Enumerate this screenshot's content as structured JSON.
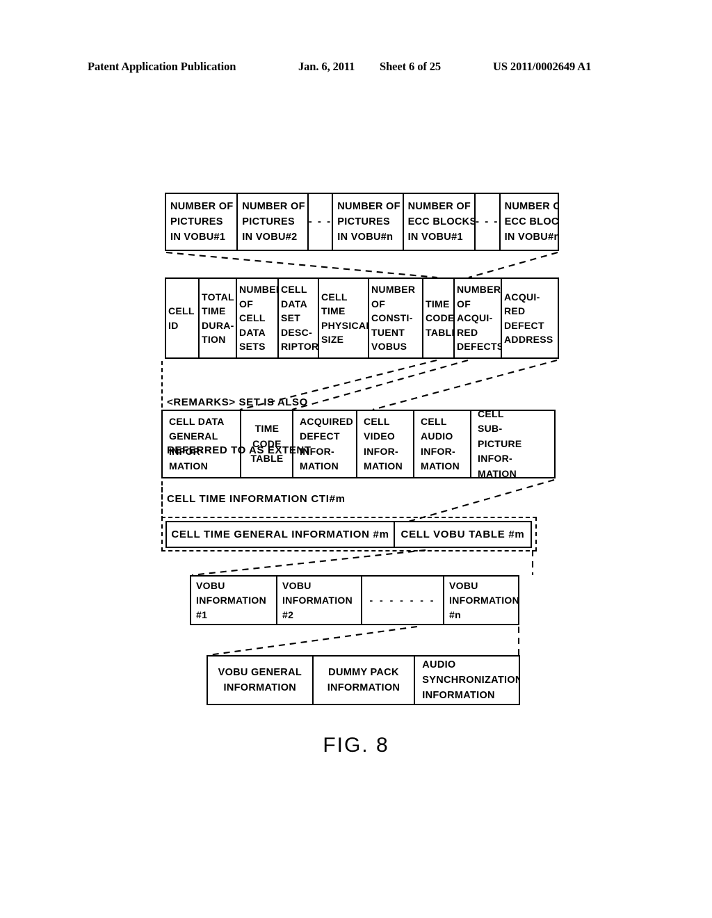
{
  "header": {
    "publication": "Patent Application Publication",
    "date": "Jan. 6, 2011",
    "sheet": "Sheet 6 of 25",
    "patent_number": "US 2011/0002649 A1"
  },
  "figure": {
    "caption": "FIG. 8",
    "remarks": {
      "line1": "<REMARKS> SET IS ALSO",
      "line2": "REFERRED TO AS EXTENT"
    },
    "cti_label": "CELL TIME INFORMATION CTI#m",
    "table1": {
      "name": "vobu-picture-count-table",
      "cells": [
        {
          "lines": [
            "NUMBER OF",
            "PICTURES",
            "IN VOBU#1"
          ],
          "type": "text"
        },
        {
          "lines": [
            "NUMBER OF",
            "PICTURES",
            "IN VOBU#2"
          ],
          "type": "text"
        },
        {
          "lines": [
            "- - -"
          ],
          "type": "ellipsis"
        },
        {
          "lines": [
            "NUMBER OF",
            "PICTURES",
            "IN VOBU#n"
          ],
          "type": "text"
        },
        {
          "lines": [
            "NUMBER OF",
            "ECC BLOCKS",
            "IN VOBU#1"
          ],
          "type": "text"
        },
        {
          "lines": [
            "- - -"
          ],
          "type": "ellipsis"
        },
        {
          "lines": [
            "NUMBER OF",
            "ECC BLOCKS",
            "IN VOBU#n"
          ],
          "type": "text"
        }
      ]
    },
    "table2": {
      "name": "cell-data-set-descriptor-table",
      "cells": [
        {
          "lines": [
            "CELL",
            "ID"
          ]
        },
        {
          "lines": [
            "TOTAL",
            "TIME",
            "DURA-",
            "TION"
          ]
        },
        {
          "lines": [
            "NUMBER",
            "OF",
            "CELL",
            "DATA",
            "SETS"
          ]
        },
        {
          "lines": [
            "CELL",
            "DATA",
            "SET",
            "DESC-",
            "RIPTOR"
          ]
        },
        {
          "lines": [
            "CELL",
            "TIME",
            "PHYSICAL",
            "SIZE"
          ]
        },
        {
          "lines": [
            "NUMBER",
            "OF",
            "CONSTI-",
            "TUENT",
            "VOBUS"
          ]
        },
        {
          "lines": [
            "TIME",
            "CODE",
            "TABLE"
          ]
        },
        {
          "lines": [
            "NUMBER",
            "OF",
            "ACQUI-",
            "RED",
            "DEFECTS"
          ]
        },
        {
          "lines": [
            "ACQUI-",
            "RED",
            "DEFECT",
            "ADDRESS"
          ]
        }
      ]
    },
    "table3": {
      "name": "cell-data-general-information-table",
      "cells": [
        {
          "lines": [
            "CELL DATA",
            "GENERAL",
            "INFOR-",
            "MATION"
          ]
        },
        {
          "lines": [
            "TIME",
            "CODE",
            "TABLE"
          ]
        },
        {
          "lines": [
            "ACQUIRED",
            "DEFECT",
            "INFOR-",
            "MATION"
          ]
        },
        {
          "lines": [
            "CELL",
            "VIDEO",
            "INFOR-",
            "MATION"
          ]
        },
        {
          "lines": [
            "CELL",
            "AUDIO",
            "INFOR-",
            "MATION"
          ]
        },
        {
          "lines": [
            "CELL",
            "SUB-",
            "PICTURE",
            "INFOR-",
            "MATION"
          ]
        }
      ]
    },
    "table4": {
      "name": "cell-time-information-table",
      "cells": [
        {
          "lines": [
            "CELL TIME GENERAL INFORMATION #m"
          ]
        },
        {
          "lines": [
            "CELL VOBU TABLE #m"
          ]
        }
      ]
    },
    "table5": {
      "name": "vobu-information-table",
      "cells": [
        {
          "lines": [
            "VOBU",
            "INFORMATION",
            "#1"
          ],
          "type": "text"
        },
        {
          "lines": [
            "VOBU",
            "INFORMATION",
            "#2"
          ],
          "type": "text"
        },
        {
          "lines": [
            "- - - - - - -"
          ],
          "type": "ellipsis"
        },
        {
          "lines": [
            "VOBU",
            "INFORMATION",
            "#n"
          ],
          "type": "text"
        }
      ]
    },
    "table6": {
      "name": "vobu-general-information-table",
      "cells": [
        {
          "lines": [
            "VOBU GENERAL",
            "INFORMATION"
          ],
          "align": "center"
        },
        {
          "lines": [
            "DUMMY PACK",
            "INFORMATION"
          ],
          "align": "center"
        },
        {
          "lines": [
            "AUDIO",
            "SYNCHRONIZATION",
            "INFORMATION"
          ],
          "align": "left"
        }
      ]
    }
  }
}
